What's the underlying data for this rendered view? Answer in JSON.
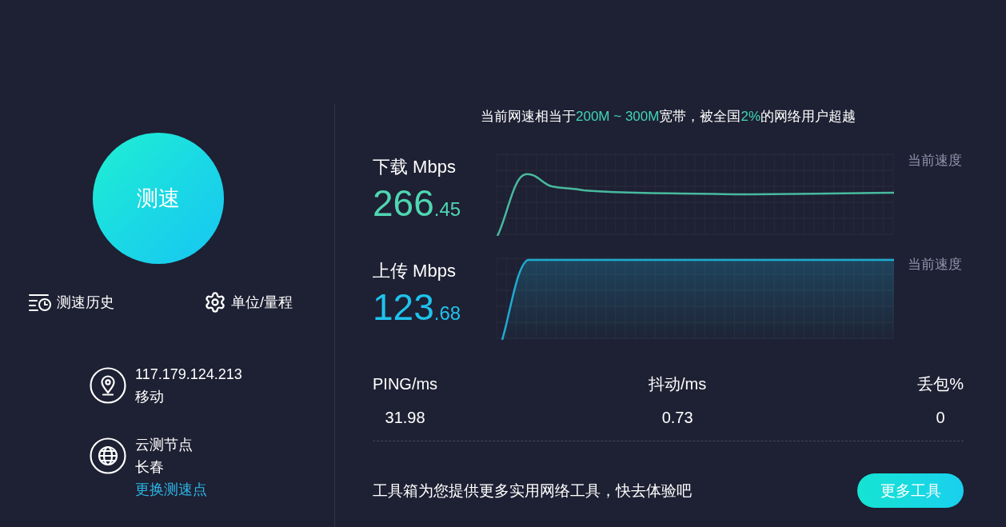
{
  "speed_test_button": {
    "label": "测速"
  },
  "tools": [
    {
      "kind": "history",
      "label": "测速历史"
    },
    {
      "kind": "settings",
      "label": "单位/量程"
    }
  ],
  "connection": [
    {
      "kind": "location",
      "lines": [
        "117.179.124.213",
        "移动"
      ]
    },
    {
      "kind": "node",
      "lines": [
        "云测节点",
        "长春"
      ],
      "link": "更换测速点"
    }
  ],
  "summary": [
    {
      "text": "当前网速相当于",
      "highlight": false
    },
    {
      "text": "200M ~ 300M",
      "highlight": true
    },
    {
      "text": "宽带，被全国",
      "highlight": false
    },
    {
      "text": "2%",
      "highlight": true
    },
    {
      "text": "的网络用户超越",
      "highlight": false
    }
  ],
  "meters": [
    {
      "kind": "download",
      "label": "下载 Mbps",
      "value_integer": "266",
      "value_decimal": ".45",
      "color": "#4fd6b2",
      "current_label": "当前速度"
    },
    {
      "kind": "upload",
      "label": "上传 Mbps",
      "value_integer": "123",
      "value_decimal": ".68",
      "color": "#1fc3ec",
      "current_label": "当前速度"
    }
  ],
  "stats": [
    {
      "label": "PING/ms",
      "value": "31.98"
    },
    {
      "label": "抖动/ms",
      "value": "0.73"
    },
    {
      "label": "丢包%",
      "value": "0"
    }
  ],
  "footer": {
    "text": "工具箱为您提供更多实用网络工具，快去体验吧",
    "button": "更多工具"
  }
}
